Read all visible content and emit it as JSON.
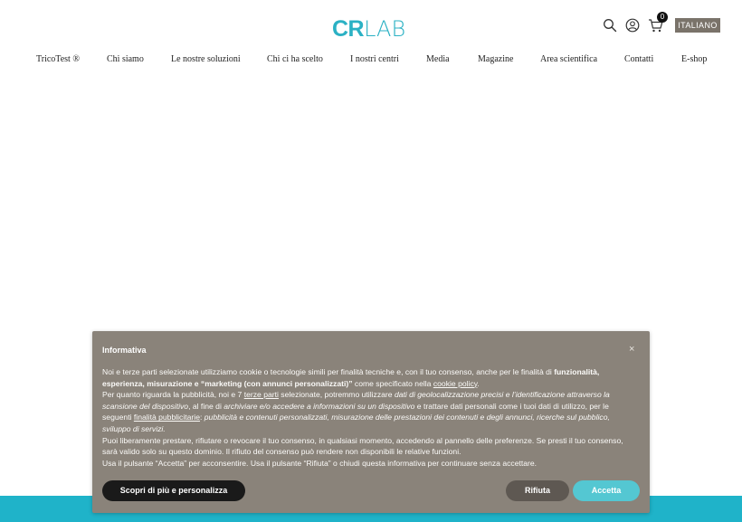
{
  "header": {
    "logo_cr": "CR",
    "logo_lab": "LAB",
    "cart_count": "0",
    "language": "ITALIANO"
  },
  "nav": {
    "items": [
      "TricoTest ®",
      "Chi siamo",
      "Le nostre soluzioni",
      "Chi ci ha scelto",
      "I nostri centri",
      "Media",
      "Magazine",
      "Area scientifica",
      "Contatti",
      "E-shop"
    ]
  },
  "cookie": {
    "title": "Informativa",
    "close": "×",
    "p1_a": "Noi e terze parti selezionate utilizziamo cookie o tecnologie simili per finalità tecniche e, con il tuo consenso, anche per le finalità di ",
    "p1_b": "funzionalità, esperienza, misurazione e “marketing (con annunci personalizzati)”",
    "p1_c": " come specificato nella ",
    "p1_link": "cookie policy",
    "p1_d": ".",
    "p2_a": "Per quanto riguarda la pubblicità, noi e 7 ",
    "p2_link1": "terze parti",
    "p2_b": " selezionate, potremmo utilizzare ",
    "p2_i1": "dati di geolocalizzazione precisi e l’identificazione attraverso la scansione del dispositivo",
    "p2_c": ", al fine di ",
    "p2_i2": "archiviare e/o accedere a informazioni su un dispositivo",
    "p2_d": " e trattare dati personali come i tuoi dati di utilizzo, per le seguenti ",
    "p2_link2": "finalità pubblicitarie",
    "p2_e": ": ",
    "p2_i3": "pubblicità e contenuti personalizzati, misurazione delle prestazioni dei contenuti e degli annunci, ricerche sul pubblico, sviluppo di servizi.",
    "p3": "Puoi liberamente prestare, rifiutare o revocare il tuo consenso, in qualsiasi momento, accedendo al pannello delle preferenze. Se presti il tuo consenso, sarà valido solo su questo dominio. Il rifiuto del consenso può rendere non disponibili le relative funzioni.",
    "p4": "Usa il pulsante “Accetta” per acconsentire. Usa il pulsante “Rifiuta” o chiudi questa informativa per continuare senza accettare.",
    "btn_more": "Scopri di più e personalizza",
    "btn_reject": "Rifiuta",
    "btn_accept": "Accetta"
  },
  "colors": {
    "brand": "#2bb1c4",
    "banner_bg": "#8a837a",
    "accept": "#54c7d2",
    "teal_strip": "#1fb3c9"
  },
  "icons": [
    "search-icon",
    "user-icon",
    "cart-icon"
  ]
}
